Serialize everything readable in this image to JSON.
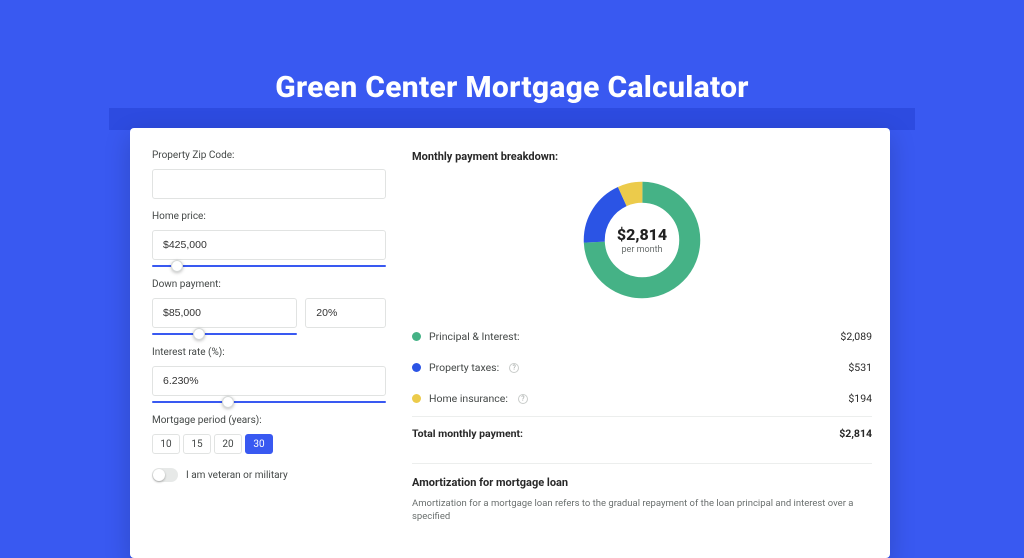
{
  "title": "Green Center Mortgage Calculator",
  "form": {
    "zip_label": "Property Zip Code:",
    "zip_value": "",
    "home_price_label": "Home price:",
    "home_price_value": "$425,000",
    "down_payment_label": "Down payment:",
    "down_payment_value": "$85,000",
    "down_payment_pct": "20%",
    "interest_label": "Interest rate (%):",
    "interest_value": "6.230%",
    "period_label": "Mortgage period (years):",
    "periods": [
      "10",
      "15",
      "20",
      "30"
    ],
    "period_selected": 3,
    "veteran_label": "I am veteran or military"
  },
  "breakdown": {
    "heading": "Monthly payment breakdown:",
    "donut_amount": "$2,814",
    "donut_sub": "per month",
    "items": [
      {
        "label": "Principal & Interest:",
        "value": "$2,089",
        "color": "#45b286",
        "help": false
      },
      {
        "label": "Property taxes:",
        "value": "$531",
        "color": "#2b54e5",
        "help": true
      },
      {
        "label": "Home insurance:",
        "value": "$194",
        "color": "#eccb4b",
        "help": true
      }
    ],
    "total_label": "Total monthly payment:",
    "total_value": "$2,814"
  },
  "chart_data": {
    "type": "pie",
    "title": "Monthly payment breakdown",
    "series": [
      {
        "name": "Principal & Interest",
        "value": 2089,
        "color": "#45b286"
      },
      {
        "name": "Property taxes",
        "value": 531,
        "color": "#2b54e5"
      },
      {
        "name": "Home insurance",
        "value": 194,
        "color": "#eccb4b"
      }
    ],
    "total": 2814,
    "center_label": "$2,814 per month"
  },
  "amortization": {
    "title": "Amortization for mortgage loan",
    "text": "Amortization for a mortgage loan refers to the gradual repayment of the loan principal and interest over a specified"
  }
}
